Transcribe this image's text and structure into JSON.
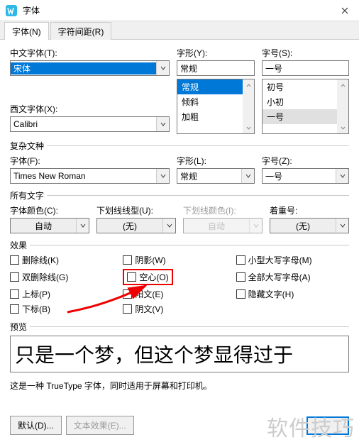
{
  "window": {
    "title": "字体"
  },
  "tabs": {
    "font": "字体(N)",
    "spacing": "字符间距(R)"
  },
  "labels": {
    "cnFont": "中文字体(T):",
    "westFont": "西文字体(X):",
    "style": "字形(Y):",
    "size": "字号(S):",
    "complexHeader": "复杂文种",
    "complexFont": "字体(F):",
    "complexStyle": "字形(L):",
    "complexSize": "字号(Z):",
    "allHeader": "所有文字",
    "fontColor": "字体颜色(C):",
    "underlineStyle": "下划线线型(U):",
    "underlineColor": "下划线颜色(I):",
    "emphasis": "着重号:",
    "effectsHeader": "效果",
    "previewHeader": "预览"
  },
  "values": {
    "cnFont": "宋体",
    "westFont": "Calibri",
    "style": "常规",
    "size": "一号",
    "complexFont": "Times New Roman",
    "complexStyle": "常规",
    "complexSize": "一号",
    "fontColor": "自动",
    "underlineStyle": "(无)",
    "underlineColor": "自动",
    "emphasis": "(无)"
  },
  "styleOptions": [
    "常规",
    "倾斜",
    "加粗"
  ],
  "sizeOptions": [
    "初号",
    "小初",
    "一号"
  ],
  "effects": {
    "strike": "删除线(K)",
    "dblStrike": "双删除线(G)",
    "superscript": "上标(P)",
    "subscript": "下标(B)",
    "shadow": "阴影(W)",
    "outline": "空心(O)",
    "emboss": "阳文(E)",
    "engrave": "阴文(V)",
    "smallCaps": "小型大写字母(M)",
    "allCaps": "全部大写字母(A)",
    "hidden": "隐藏文字(H)"
  },
  "preview": {
    "text": "只是一个梦，但这个梦显得过于",
    "desc": "这是一种 TrueType 字体，同时适用于屏幕和打印机。"
  },
  "buttons": {
    "default": "默认(D)...",
    "textEffects": "文本效果(E)..."
  },
  "watermark": "软件技巧"
}
